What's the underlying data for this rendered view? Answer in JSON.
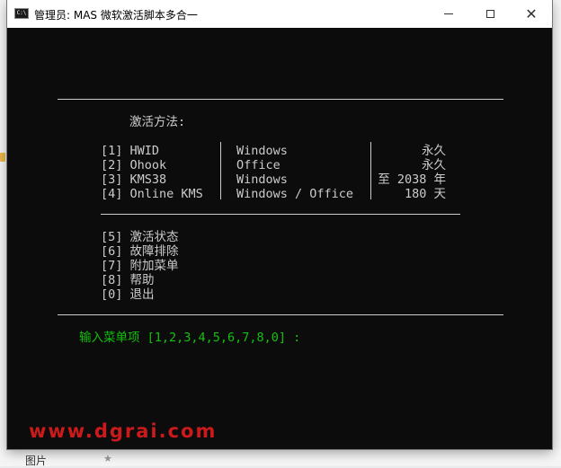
{
  "window": {
    "title": "管理员:  MAS 微软激活脚本多合一",
    "icon": "cmd-icon",
    "controls": [
      "minimize",
      "maximize",
      "close"
    ]
  },
  "menu": {
    "heading": "激活方法:",
    "activation_rows": [
      {
        "key": "[1] HWID",
        "product": "Windows",
        "duration": "永久"
      },
      {
        "key": "[2] Ohook",
        "product": "Office",
        "duration": "永久"
      },
      {
        "key": "[3] KMS38",
        "product": "Windows",
        "duration": "至 2038 年"
      },
      {
        "key": "[4] Online KMS",
        "product": "Windows / Office",
        "duration": "180 天"
      }
    ],
    "other_items": [
      "[5] 激活状态",
      "[6] 故障排除",
      "[7] 附加菜单",
      "[8] 帮助",
      "[0] 退出"
    ],
    "prompt": "输入菜单项 [1,2,3,4,5,6,7,8,0] :"
  },
  "background": {
    "bottom_label": "图片",
    "watermark": "www.dgrai.com"
  },
  "colors": {
    "console_bg": "#0c0c0c",
    "console_text": "#cccccc",
    "prompt": "#13c10e",
    "watermark": "#cc1a1a"
  }
}
